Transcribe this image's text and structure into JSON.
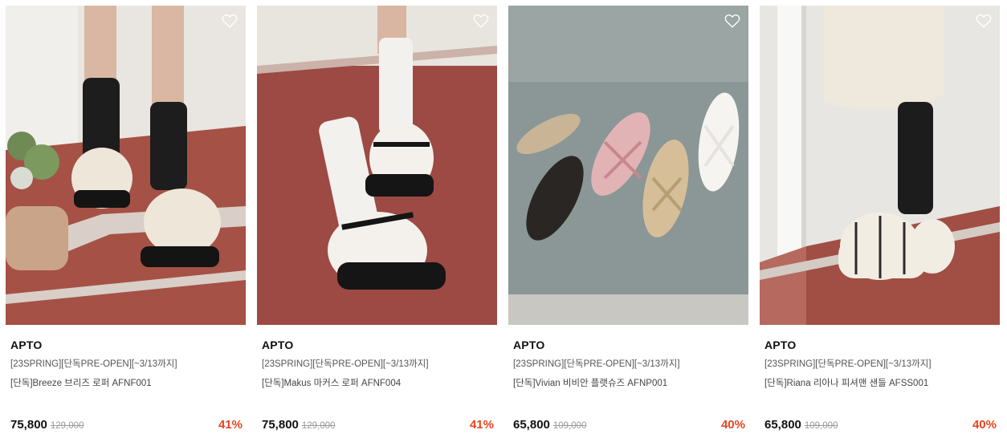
{
  "colors": {
    "discount": "#e8431e",
    "wish_icon": "#ffffff"
  },
  "products": [
    {
      "brand": "APTO",
      "tag": "[23SPRING][단독PRE-OPEN][~3/13까지]",
      "name": "[단독]Breeze 브리즈 로퍼 AFNF001",
      "price": "75,800",
      "original_price": "129,000",
      "discount": "41%",
      "wish_icon": "heart-outline-icon"
    },
    {
      "brand": "APTO",
      "tag": "[23SPRING][단독PRE-OPEN][~3/13까지]",
      "name": "[단독]Makus 마커스 로퍼 AFNF004",
      "price": "75,800",
      "original_price": "129,000",
      "discount": "41%",
      "wish_icon": "heart-outline-icon"
    },
    {
      "brand": "APTO",
      "tag": "[23SPRING][단독PRE-OPEN][~3/13까지]",
      "name": "[단독]Vivian 비비안 플랫슈즈 AFNP001",
      "price": "65,800",
      "original_price": "109,000",
      "discount": "40%",
      "wish_icon": "heart-outline-icon"
    },
    {
      "brand": "APTO",
      "tag": "[23SPRING][단독PRE-OPEN][~3/13까지]",
      "name": "[단독]Riana 리아나 피셔맨 샌들 AFSS001",
      "price": "65,800",
      "original_price": "109,000",
      "discount": "40%",
      "wish_icon": "heart-outline-icon"
    }
  ]
}
